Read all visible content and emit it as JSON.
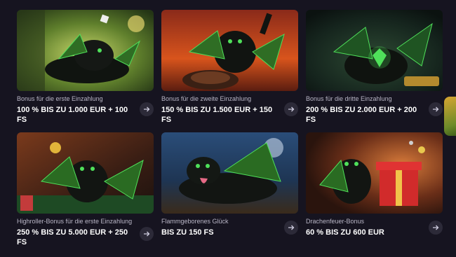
{
  "cards": [
    {
      "subtitle": "Bonus für die erste Einzahlung",
      "title": "100 % BIS ZU 1.000 EUR + 100 FS",
      "image_icon": "dragon-casino-icon"
    },
    {
      "subtitle": "Bonus für die zweite Einzahlung",
      "title": "150 % BIS ZU 1.500 EUR + 150 FS",
      "image_icon": "dragon-roulette-icon"
    },
    {
      "subtitle": "Bonus für die dritte Einzahlung",
      "title": "200 % BIS ZU 2.000 EUR + 200 FS",
      "image_icon": "dragon-diamond-icon"
    },
    {
      "subtitle": "Highroller-Bonus für die erste Einzahlung",
      "title": "250 % BIS ZU 5.000 EUR + 250 FS",
      "image_icon": "dragon-coin-icon"
    },
    {
      "subtitle": "Flammgeborenes Glück",
      "title": "BIS ZU 150 FS",
      "image_icon": "dragon-night-icon"
    },
    {
      "subtitle": "Drachenfeuer-Bonus",
      "title": "60 % BIS ZU 600 EUR",
      "image_icon": "dragon-gift-icon"
    }
  ],
  "arrow_icon": "arrow-right-icon",
  "colors": {
    "background": "#161420",
    "button": "#2c2a38",
    "subtitle": "#b9b6c6",
    "dragon_glow": "#39e35a"
  }
}
